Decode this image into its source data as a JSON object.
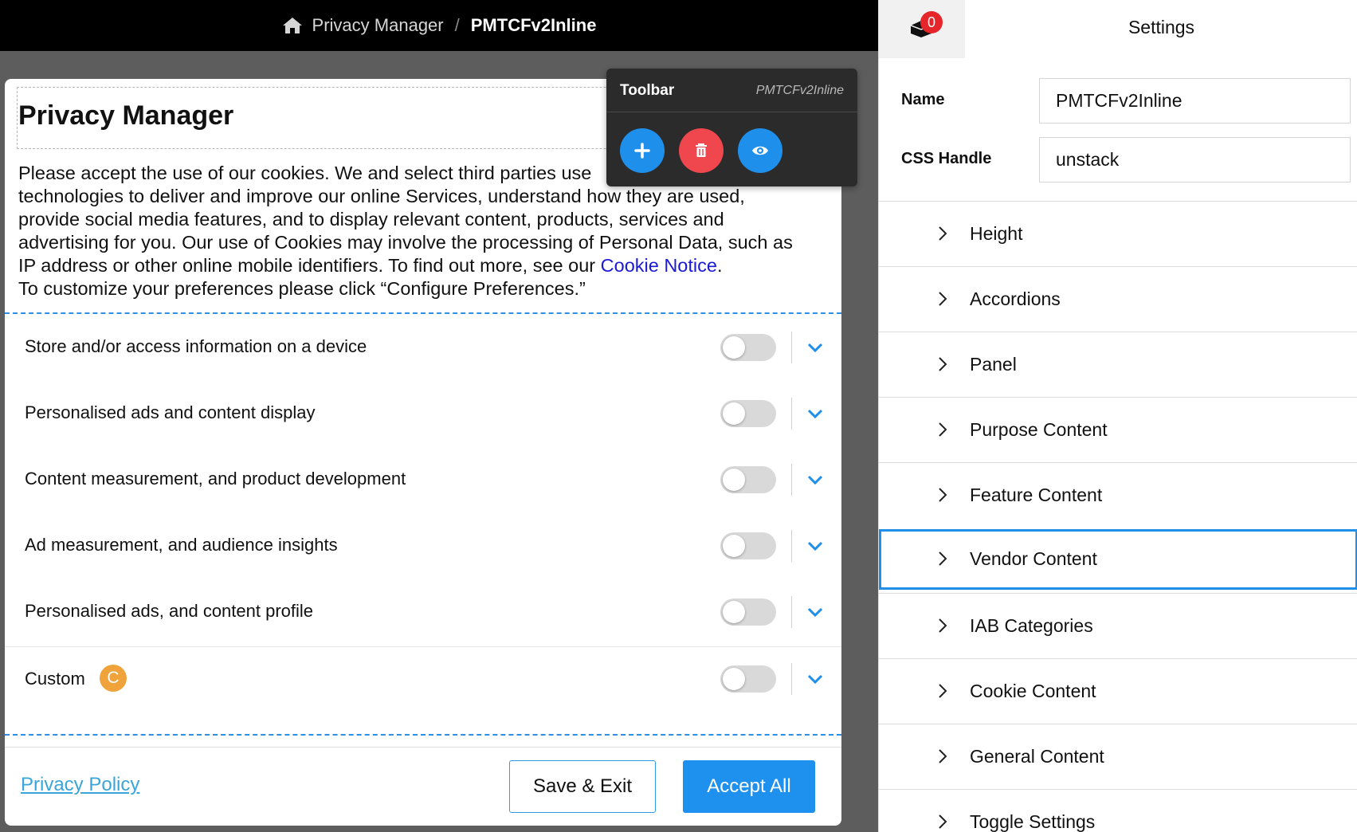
{
  "breadcrumb": {
    "home_icon": "home-icon",
    "parent": "Privacy Manager",
    "separator": "/",
    "current": "PMTCFv2Inline"
  },
  "privacy_manager": {
    "title": "Privacy Manager",
    "body_lines": [
      "Please accept the use of our cookies. We and select third parties use",
      "technologies to deliver and improve our online Services, understand how they are used,",
      "provide social media features, and to display relevant content, products, services and",
      "advertising for you. Our use of Cookies may involve the processing of Personal Data, such as"
    ],
    "body_line5_prefix": "IP address or other online mobile identifiers. To find out more, see our ",
    "cookie_notice_link": "Cookie Notice",
    "body_line5_suffix": ".",
    "body_line6": "To customize your preferences please click “Configure Preferences.”",
    "purposes": [
      {
        "label": "Store and/or access information on a device",
        "enabled": false
      },
      {
        "label": "Personalised ads and content display",
        "enabled": false
      },
      {
        "label": "Content measurement, and product development",
        "enabled": false
      },
      {
        "label": "Ad measurement, and audience insights",
        "enabled": false
      },
      {
        "label": "Personalised ads, and content profile",
        "enabled": false
      }
    ],
    "custom": {
      "label": "Custom",
      "badge": "C",
      "enabled": false
    },
    "privacy_policy_link": "Privacy Policy",
    "save_exit_label": "Save & Exit",
    "accept_all_label": "Accept All"
  },
  "toolbar": {
    "title": "Toolbar",
    "subtitle": "PMTCFv2Inline",
    "buttons": [
      {
        "name": "add",
        "icon": "plus-icon",
        "color": "#1f8fec"
      },
      {
        "name": "delete",
        "icon": "trash-icon",
        "color": "#f0474f"
      },
      {
        "name": "preview",
        "icon": "eye-icon",
        "color": "#1f8fec"
      }
    ]
  },
  "settings": {
    "title": "Settings",
    "notification_icon": "component-icon",
    "notification_count": "0",
    "name_label": "Name",
    "name_value": "PMTCFv2Inline",
    "css_handle_label": "CSS Handle",
    "css_handle_value": "unstack",
    "sections": [
      {
        "label": "Height",
        "selected": false
      },
      {
        "label": "Accordions",
        "selected": false
      },
      {
        "label": "Panel",
        "selected": false
      },
      {
        "label": "Purpose Content",
        "selected": false
      },
      {
        "label": "Feature Content",
        "selected": false
      },
      {
        "label": "Vendor Content",
        "selected": true
      },
      {
        "label": "IAB Categories",
        "selected": false
      },
      {
        "label": "Cookie Content",
        "selected": false
      },
      {
        "label": "General Content",
        "selected": false
      },
      {
        "label": "Toggle Settings",
        "selected": false
      }
    ]
  }
}
